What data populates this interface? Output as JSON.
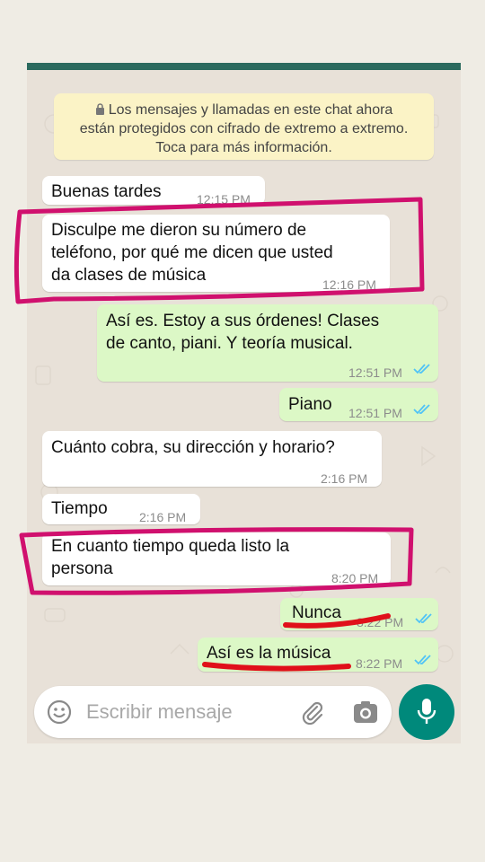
{
  "encryption_notice": {
    "line1": "Los mensajes y llamadas en este chat ahora",
    "line2": "están protegidos con cifrado de extremo a extremo.",
    "line3": "Toca para más información."
  },
  "messages": [
    {
      "text": "Buenas tardes",
      "time": "12:15 PM",
      "direction": "incoming"
    },
    {
      "text": "Disculpe me dieron su número de\nteléfono, por qué me dicen que usted\nda clases de música",
      "time": "12:16 PM",
      "direction": "incoming"
    },
    {
      "text": "Así es. Estoy a sus órdenes! Clases\nde canto, piani. Y teoría musical.",
      "time": "12:51 PM",
      "direction": "outgoing",
      "status": "read"
    },
    {
      "text": "Piano",
      "time": "12:51 PM",
      "direction": "outgoing",
      "status": "read"
    },
    {
      "text": "Cuánto cobra, su dirección y horario?",
      "time": "2:16 PM",
      "direction": "incoming"
    },
    {
      "text": "Tiempo",
      "time": "2:16 PM",
      "direction": "incoming"
    },
    {
      "text": "En cuanto tiempo queda listo la\npersona",
      "time": "8:20 PM",
      "direction": "incoming"
    },
    {
      "text": "Nunca",
      "time": "8:22 PM",
      "direction": "outgoing",
      "status": "read"
    },
    {
      "text": "Así es la música",
      "time": "8:22 PM",
      "direction": "outgoing",
      "status": "read"
    }
  ],
  "composer": {
    "placeholder": "Escribir mensaje"
  },
  "icons": {
    "emoji": "emoji-icon",
    "attach": "paperclip-icon",
    "camera": "camera-icon",
    "mic": "microphone-icon",
    "lock": "lock-icon",
    "ticks": "double-check-icon"
  },
  "colors": {
    "header": "#2b6a5e",
    "incoming_bubble": "#ffffff",
    "outgoing_bubble": "#dcf8c6",
    "notice_bg": "#fbf3c6",
    "read_ticks": "#4fc3f7",
    "mic_button": "#00897b",
    "annotation_magenta": "#d0106e",
    "annotation_red": "#e0101a"
  }
}
